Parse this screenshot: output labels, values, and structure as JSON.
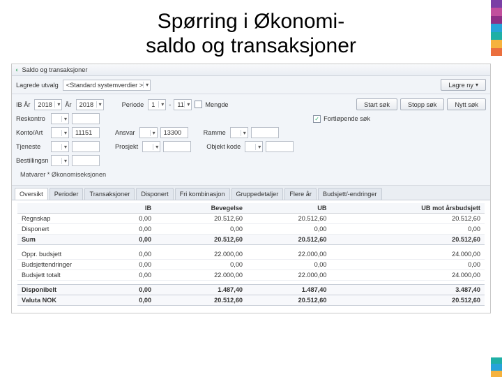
{
  "slide_title_line1": "Spørring i Økonomi-",
  "slide_title_line2": "saldo og transaksjoner",
  "window_title": "Saldo og transaksjoner",
  "toolbar": {
    "saved_selection_label": "Lagrede utvalg",
    "saved_selection_value": "<Standard systemverdier >",
    "save_new": "Lagre ny"
  },
  "filters": {
    "ib_year_label": "IB År",
    "ib_year_value": "2018",
    "year_label": "År",
    "year_value": "2018",
    "period_label": "Periode",
    "period_from": "1",
    "period_to": "11",
    "mengde_label": "Mengde",
    "start_search": "Start søk",
    "stop_search": "Stopp søk",
    "new_search": "Nytt søk",
    "fortlopende_label": "Fortløpende søk",
    "row_reskontro": "Reskontro",
    "row_konto": "Konto/Art",
    "konto_value": "11151",
    "row_ansvar": "Ansvar",
    "ansvar_value": "13300",
    "row_ramme": "Ramme",
    "row_tjeneste": "Tjeneste",
    "row_prosjekt": "Prosjekt",
    "row_objekt": "Objekt kode",
    "row_bestilling": "Bestillingsn",
    "description": "Matvarer * Økonomiseksjonen"
  },
  "tabs": [
    "Oversikt",
    "Perioder",
    "Transaksjoner",
    "Disponert",
    "Fri kombinasjon",
    "Gruppedetaljer",
    "Flere år",
    "Budsjett/-endringer"
  ],
  "columns": [
    "",
    "IB",
    "Bevegelse",
    "UB",
    "UB mot årsbudsjett"
  ],
  "rows": [
    {
      "label": "Regnskap",
      "ib": "0,00",
      "bev": "20.512,60",
      "ub": "20.512,60",
      "ubmot": "20.512,60"
    },
    {
      "label": "Disponert",
      "ib": "0,00",
      "bev": "0,00",
      "ub": "0,00",
      "ubmot": "0,00"
    }
  ],
  "sum_row": {
    "label": "Sum",
    "ib": "0,00",
    "bev": "20.512,60",
    "ub": "20.512,60",
    "ubmot": "20.512,60"
  },
  "rows2": [
    {
      "label": "Oppr. budsjett",
      "ib": "0,00",
      "bev": "22.000,00",
      "ub": "22.000,00",
      "ubmot": "24.000,00"
    },
    {
      "label": "Budsjettendringer",
      "ib": "0,00",
      "bev": "0,00",
      "ub": "0,00",
      "ubmot": "0,00"
    },
    {
      "label": "Budsjett totalt",
      "ib": "0,00",
      "bev": "22.000,00",
      "ub": "22.000,00",
      "ubmot": "24.000,00"
    }
  ],
  "disp_row": {
    "label": "Disponibelt",
    "ib": "0,00",
    "bev": "1.487,40",
    "ub": "1.487,40",
    "ubmot": "3.487,40"
  },
  "valuta_row": {
    "label": "Valuta   NOK",
    "ib": "0,00",
    "bev": "20.512,60",
    "ub": "20.512,60",
    "ubmot": "20.512,60"
  },
  "stripe_colors": [
    "#7a3fa5",
    "#c14f9d",
    "#8e2f86",
    "#27a3d9",
    "#1fb0a6",
    "#f6b23d",
    "#eb6f3e"
  ],
  "stripe_bot_colors": [
    "#1fb0a6",
    "#27a3d9",
    "#f6b23d"
  ]
}
